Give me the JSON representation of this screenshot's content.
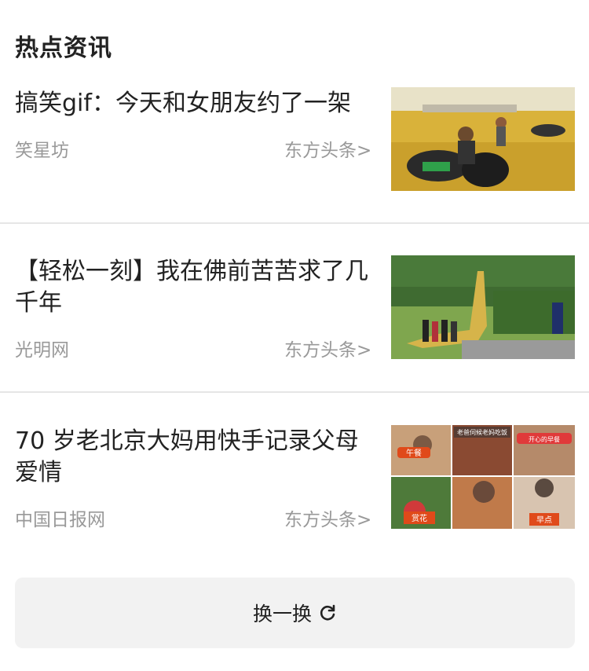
{
  "section": {
    "title": "热点资讯"
  },
  "news": [
    {
      "title": "搞笑gif：今天和女朋友约了一架",
      "source": "笑星坊",
      "publisher": "东方头条>",
      "thumb_icon": "desert-atv-photo"
    },
    {
      "title": "【轻松一刻】我在佛前苦苦求了几千年",
      "source": "光明网",
      "publisher": "东方头条>",
      "thumb_icon": "park-statue-photo"
    },
    {
      "title": "70 岁老北京大妈用快手记录父母爱情",
      "source": "中国日报网",
      "publisher": "东方头条>",
      "thumb_icon": "collage-photo",
      "thumb_captions": [
        "午餐",
        "老爸伺候老妈吃饭",
        "开心的早餐",
        "赏花",
        "早点"
      ]
    }
  ],
  "refresh": {
    "label": "换一换",
    "icon": "refresh-icon"
  },
  "colors": {
    "text": "#222222",
    "meta": "#999999",
    "divider": "#e6e6e6",
    "button_bg": "#f2f2f2"
  }
}
